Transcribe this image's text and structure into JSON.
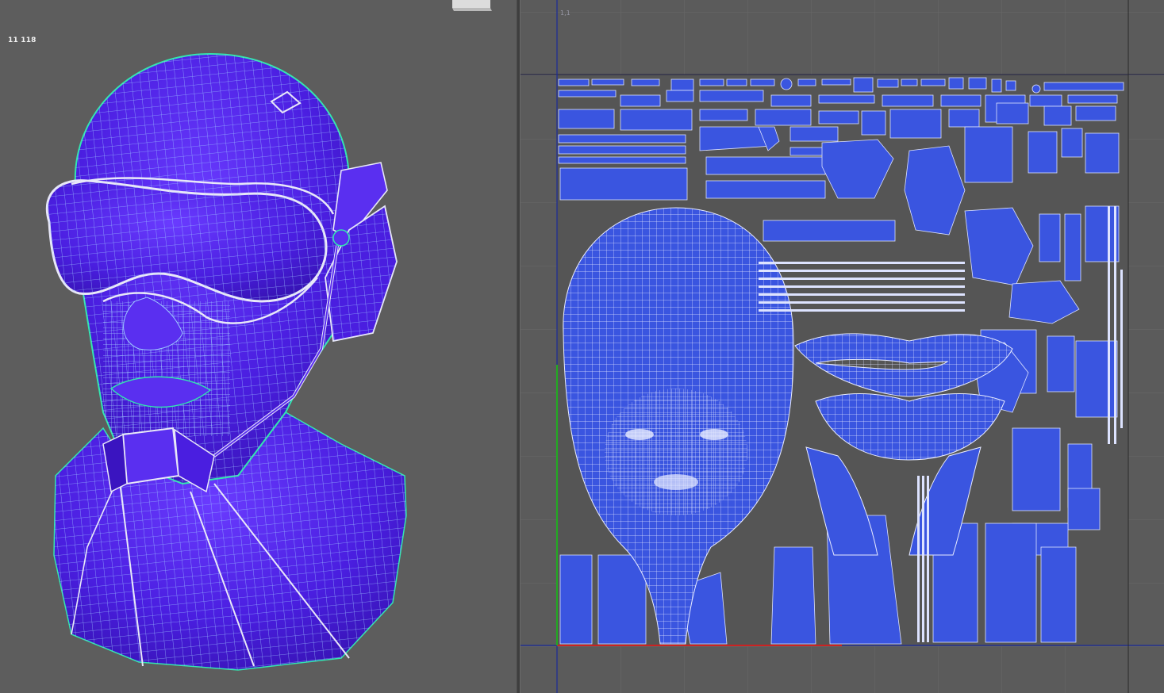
{
  "viewport": {
    "poly_count": "11 118",
    "mesh_color": "#4a1ee0",
    "wire_color": "#8fc8ff",
    "selection_edge_color": "#33e6b0",
    "background": "#5d5d5d"
  },
  "uv_editor": {
    "corner_label": "1,1",
    "uv_fill_color": "#3a55e0",
    "uv_wire_color": "#dde3ff",
    "grid_color": "#6a6a6a",
    "background": "#5b5b5b",
    "u_axis_color": "#cc2222",
    "v_axis_color": "#22aa22",
    "border_line_color": "#1a2a9a"
  }
}
